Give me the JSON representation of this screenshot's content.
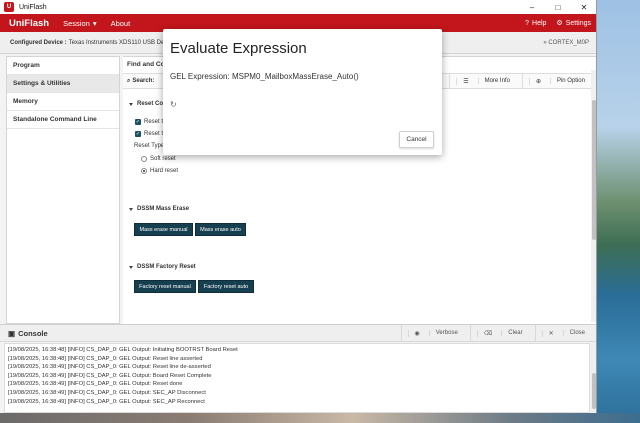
{
  "window": {
    "title": "UniFlash",
    "logo": "U",
    "controls": [
      "–",
      "□",
      "✕"
    ]
  },
  "menubar": {
    "brand": "UniFlash",
    "items": [
      {
        "label": "Session",
        "icon": "caret-down-icon"
      },
      {
        "label": "About"
      }
    ],
    "right": [
      {
        "label": "Help",
        "icon": "help-icon"
      },
      {
        "label": "Settings",
        "icon": "gear-icon"
      }
    ]
  },
  "device": {
    "label": "Configured Device :",
    "value": "Texas Instruments XDS110 USB Debug Probe",
    "right": "» CORTEX_M0P"
  },
  "sidebar": {
    "items": [
      {
        "label": "Program",
        "active": false
      },
      {
        "label": "Settings & Utilities",
        "active": true
      },
      {
        "label": "Memory",
        "active": false
      },
      {
        "label": "Standalone Command Line",
        "active": false
      }
    ]
  },
  "main": {
    "find_header": "Find and Co",
    "search_label": "Search:",
    "more_info": "More Info",
    "pin_option": "Pin Option",
    "reset_section": "Reset Co",
    "checkbox_1": "Reset t",
    "checkbox_2": "Reset t",
    "reset_type_label": "Reset Type",
    "soft_reset": "Soft reset",
    "hard_reset": "Hard reset",
    "mass_erase_section": "DSSM Mass Erase",
    "mass_erase_manual": "Mass erase manual",
    "mass_erase_auto": "Mass erase auto",
    "factory_reset_section": "DSSM Factory Reset",
    "factory_reset_manual": "Factory reset manual",
    "factory_reset_auto": "Factory reset auto"
  },
  "console": {
    "title": "Console",
    "verbose": "Verbose",
    "clear": "Clear",
    "close": "Close",
    "lines": [
      "[19/08/2025, 16:38:48] [INFO] CS_DAP_0: GEL Output: Initiating BOOTRST Board Reset",
      "[19/08/2025, 16:38:48] [INFO] CS_DAP_0: GEL Output: Reset line asserted",
      "[19/08/2025, 16:38:49] [INFO] CS_DAP_0: GEL Output: Reset line de-asserted",
      "[19/08/2025, 16:38:49] [INFO] CS_DAP_0: GEL Output: Board Reset Complete",
      "[19/08/2025, 16:38:49] [INFO] CS_DAP_0: GEL Output: Reset done",
      "[19/08/2025, 16:38:49] [INFO] CS_DAP_0: GEL Output: SEC_AP Disconnect",
      "[19/08/2025, 16:38:49] [INFO] CS_DAP_0: GEL Output: SEC_AP Reconnect"
    ]
  },
  "dialog": {
    "title": "Evaluate Expression",
    "expression": "GEL Expression: MSPM0_MailboxMassErase_Auto()",
    "spinner": "↻",
    "cancel": "Cancel"
  }
}
